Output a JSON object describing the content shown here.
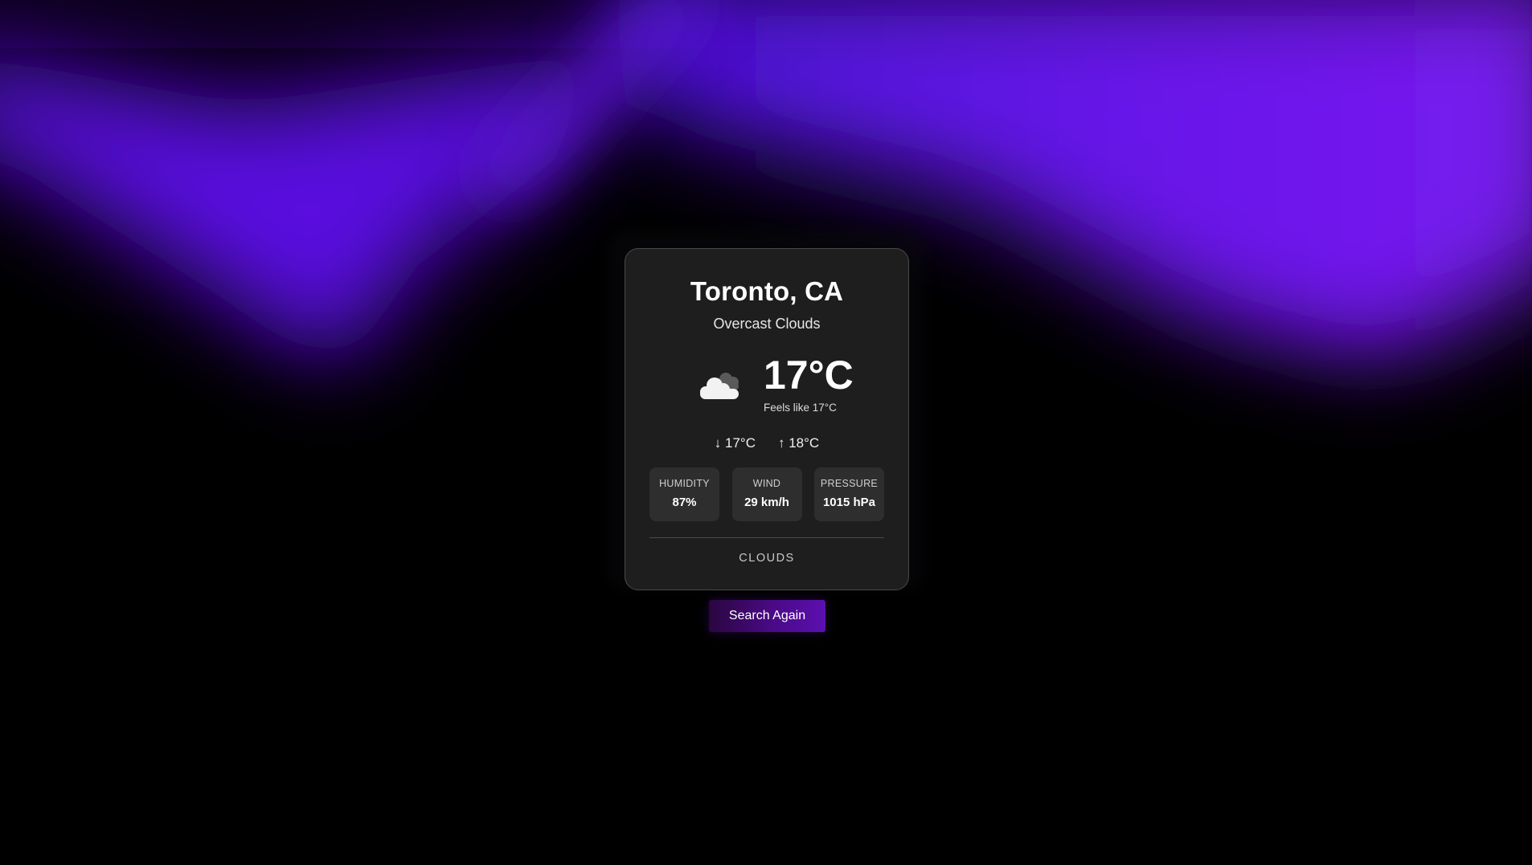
{
  "location": {
    "city_label": "Toronto, CA",
    "description": "Overcast Clouds"
  },
  "current": {
    "temperature": "17°C",
    "feels_like": "Feels like 17°C",
    "icon": "overcast-clouds-icon"
  },
  "range": {
    "min": "↓ 17°C",
    "max": "↑ 18°C"
  },
  "stats": [
    {
      "label": "Humidity",
      "value": "87%"
    },
    {
      "label": "Wind",
      "value": "29 km/h"
    },
    {
      "label": "Pressure",
      "value": "1015 hPa"
    }
  ],
  "main_condition": "Clouds",
  "actions": {
    "search_again_label": "Search Again"
  },
  "colors": {
    "background": "#000000",
    "card": "#1e1e1e",
    "stat_tile": "#2e2e2e",
    "accent_purple": "#7a18f0",
    "button_gradient_end": "#5c0fb0"
  }
}
